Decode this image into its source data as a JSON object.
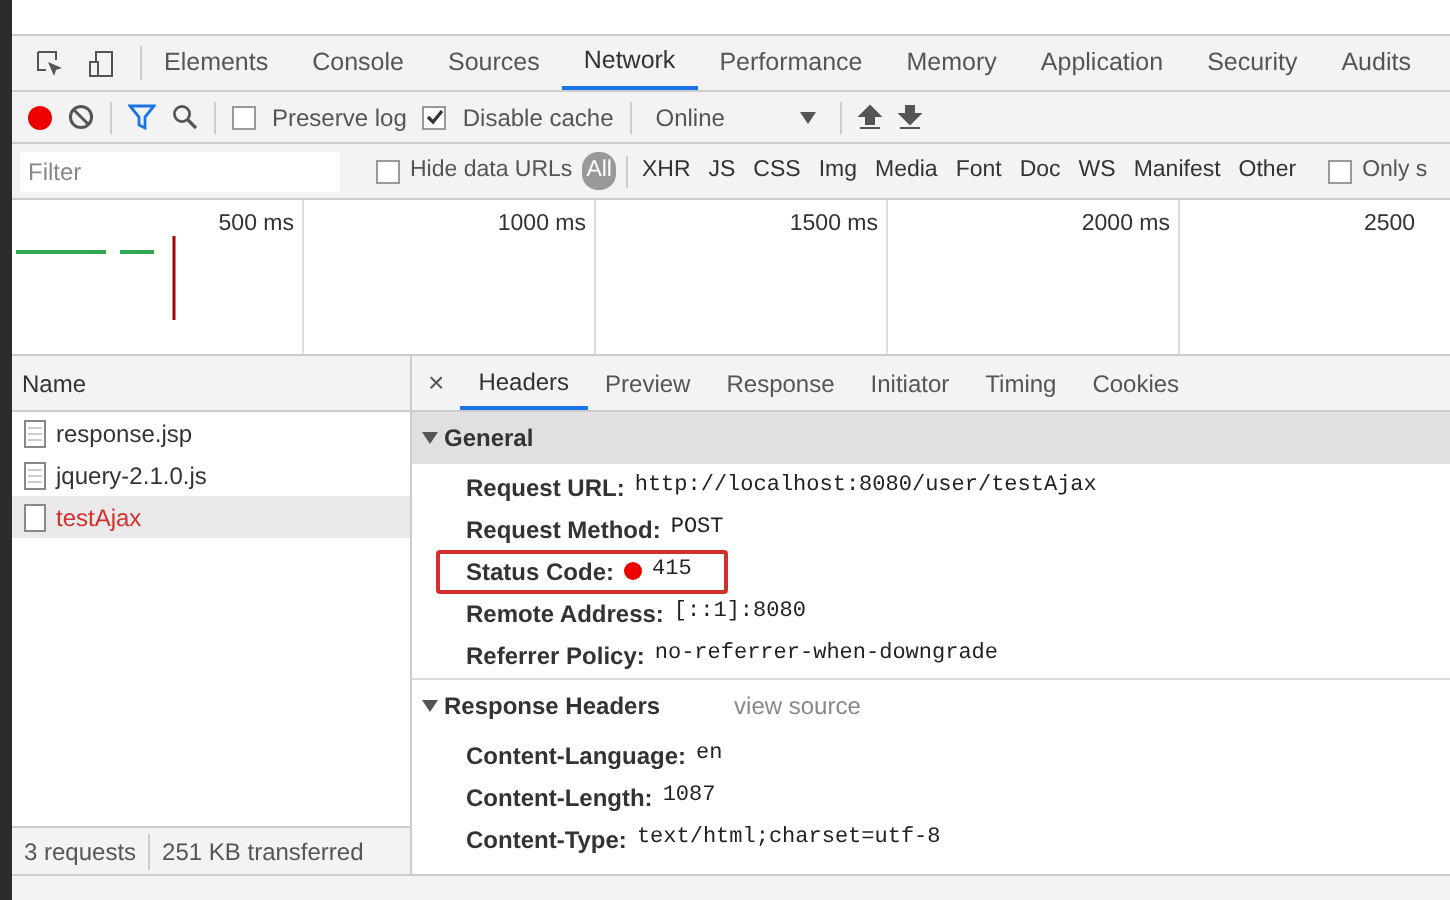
{
  "panel_tabs": [
    {
      "label": "Elements",
      "selected": false
    },
    {
      "label": "Console",
      "selected": false
    },
    {
      "label": "Sources",
      "selected": false
    },
    {
      "label": "Network",
      "selected": true
    },
    {
      "label": "Performance",
      "selected": false
    },
    {
      "label": "Memory",
      "selected": false
    },
    {
      "label": "Application",
      "selected": false
    },
    {
      "label": "Security",
      "selected": false
    },
    {
      "label": "Audits",
      "selected": false
    }
  ],
  "toolbar": {
    "recording": true,
    "preserve_log": {
      "label": "Preserve log",
      "checked": false
    },
    "disable_cache": {
      "label": "Disable cache",
      "checked": true
    },
    "throttling": "Online"
  },
  "filter_bar": {
    "placeholder": "Filter",
    "hide_data_urls": {
      "label": "Hide data URLs",
      "checked": false
    },
    "types": [
      {
        "label": "All",
        "selected": true
      },
      {
        "label": "XHR",
        "selected": false
      },
      {
        "label": "JS",
        "selected": false
      },
      {
        "label": "CSS",
        "selected": false
      },
      {
        "label": "Img",
        "selected": false
      },
      {
        "label": "Media",
        "selected": false
      },
      {
        "label": "Font",
        "selected": false
      },
      {
        "label": "Doc",
        "selected": false
      },
      {
        "label": "WS",
        "selected": false
      },
      {
        "label": "Manifest",
        "selected": false
      },
      {
        "label": "Other",
        "selected": false
      }
    ],
    "only": {
      "label": "Only s",
      "checked": false
    }
  },
  "timeline": {
    "ticks": [
      "500 ms",
      "1000 ms",
      "1500 ms",
      "2000 ms",
      "2500"
    ]
  },
  "requests": {
    "column": "Name",
    "rows": [
      {
        "name": "response.jsp",
        "selected": false,
        "error": false
      },
      {
        "name": "jquery-2.1.0.js",
        "selected": false,
        "error": false
      },
      {
        "name": "testAjax",
        "selected": true,
        "error": true
      }
    ],
    "summary": [
      "3 requests",
      "251 KB transferred"
    ]
  },
  "details": {
    "close": "×",
    "tabs": [
      {
        "label": "Headers",
        "selected": true
      },
      {
        "label": "Preview",
        "selected": false
      },
      {
        "label": "Response",
        "selected": false
      },
      {
        "label": "Initiator",
        "selected": false
      },
      {
        "label": "Timing",
        "selected": false
      },
      {
        "label": "Cookies",
        "selected": false
      }
    ],
    "sections": [
      {
        "title": "General",
        "expanded": true,
        "shaded": true,
        "headers": [
          {
            "name": "Request URL:",
            "value": "http://localhost:8080/user/testAjax",
            "highlighted": false,
            "status_dot": false
          },
          {
            "name": "Request Method:",
            "value": "POST",
            "highlighted": false,
            "status_dot": false
          },
          {
            "name": "Status Code:",
            "value": "415",
            "highlighted": true,
            "status_dot": true
          },
          {
            "name": "Remote Address:",
            "value": "[::1]:8080",
            "highlighted": false,
            "status_dot": false
          },
          {
            "name": "Referrer Policy:",
            "value": "no-referrer-when-downgrade",
            "highlighted": false,
            "status_dot": false
          }
        ]
      },
      {
        "title": "Response Headers",
        "link": "view source",
        "expanded": true,
        "shaded": false,
        "headers": [
          {
            "name": "Content-Language:",
            "value": "en",
            "highlighted": false,
            "status_dot": false
          },
          {
            "name": "Content-Length:",
            "value": "1087",
            "highlighted": false,
            "status_dot": false
          },
          {
            "name": "Content-Type:",
            "value": "text/html;charset=utf-8",
            "highlighted": false,
            "status_dot": false
          }
        ]
      }
    ]
  }
}
